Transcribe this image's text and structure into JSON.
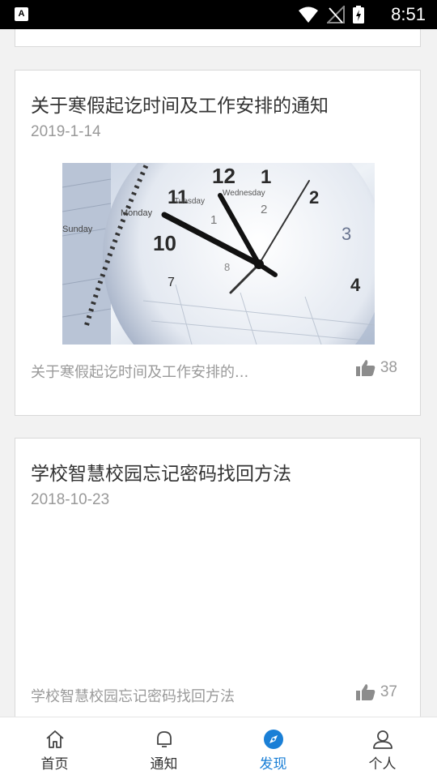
{
  "status_bar": {
    "app_badge": "A",
    "time": "8:51"
  },
  "colors": {
    "accent": "#1a7fd6",
    "text_primary": "#333333",
    "text_secondary": "#999999",
    "card_border": "#d9d9d9",
    "background": "#f2f2f2"
  },
  "cards": [
    {
      "title": "关于寒假起讫时间及工作安排的通知",
      "date": "2019-1-14",
      "image_icon": "clock-calendar-image",
      "summary": "关于寒假起讫时间及工作安排的...",
      "likes": "38"
    },
    {
      "title": "学校智慧校园忘记密码找回方法",
      "date": "2018-10-23",
      "summary": "学校智慧校园忘记密码找回方法",
      "likes": "37"
    }
  ],
  "nav": {
    "items": [
      {
        "label": "首页",
        "icon": "home-icon",
        "active": false
      },
      {
        "label": "通知",
        "icon": "bell-icon",
        "active": false
      },
      {
        "label": "发现",
        "icon": "compass-icon",
        "active": true
      },
      {
        "label": "个人",
        "icon": "user-icon",
        "active": false
      }
    ]
  }
}
